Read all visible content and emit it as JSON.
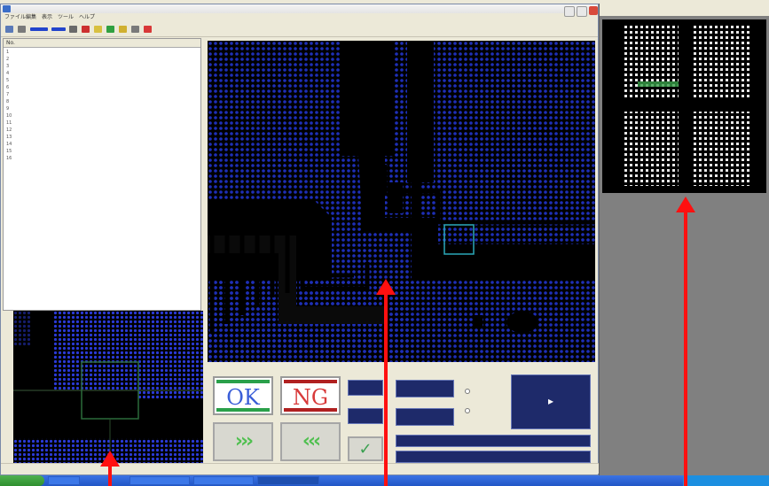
{
  "main_window": {
    "menu": [
      "ファイル",
      "編集",
      "表示",
      "ツール",
      "ヘルプ"
    ],
    "list_columns": [
      "No.",
      "",
      "",
      "",
      ""
    ],
    "rows": [
      [
        "1",
        "",
        "",
        "",
        ""
      ],
      [
        "2",
        "",
        "",
        "",
        ""
      ],
      [
        "3",
        "",
        "",
        "",
        ""
      ],
      [
        "4",
        "",
        "",
        "",
        ""
      ],
      [
        "5",
        "",
        "",
        "",
        ""
      ],
      [
        "6",
        "",
        "",
        "",
        ""
      ],
      [
        "7",
        "",
        "",
        "",
        ""
      ],
      [
        "8",
        "",
        "",
        "",
        ""
      ],
      [
        "9",
        "",
        "",
        "",
        ""
      ],
      [
        "10",
        "",
        "",
        "",
        ""
      ],
      [
        "11",
        "",
        "",
        "",
        ""
      ],
      [
        "12",
        "",
        "",
        "",
        ""
      ],
      [
        "13",
        "",
        "",
        "",
        ""
      ],
      [
        "14",
        "",
        "",
        "",
        ""
      ],
      [
        "15",
        "",
        "",
        "",
        ""
      ],
      [
        "16",
        "",
        "",
        "",
        ""
      ]
    ]
  },
  "judge_panel": {
    "section_label": "",
    "ok_label": "OK",
    "ng_label": "NG",
    "next_chevrons": "›››",
    "prev_chevrons": "‹‹‹",
    "check_glyph": "✓",
    "play_glyph": "▸",
    "field_values": [
      "",
      "",
      "",
      ""
    ],
    "info_line_1": "",
    "info_line_2": "",
    "radio_options": [
      "",
      ""
    ]
  },
  "colors": {
    "ok_text": "#3a5ed8",
    "ng_text": "#d83a3a",
    "ok_bar": "#2aa04a",
    "ng_bar": "#b02020",
    "pcb_blue": "#2030c0",
    "arrow_red": "#ff1010"
  },
  "icons": {
    "app": "app-icon",
    "start": "start-button",
    "check": "check-icon",
    "play": "play-icon"
  }
}
